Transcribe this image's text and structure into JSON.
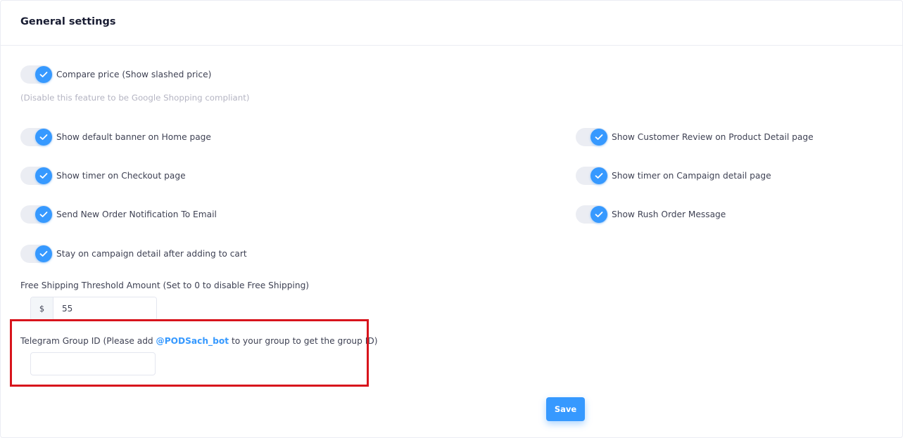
{
  "card": {
    "title": "General settings"
  },
  "toggles": {
    "compare_price": {
      "label": "Compare price (Show slashed price)",
      "checked": true
    },
    "compare_price_hint": "(Disable this feature to be Google Shopping compliant)",
    "default_banner": {
      "label": "Show default banner on Home page",
      "checked": true
    },
    "customer_review": {
      "label": "Show Customer Review on Product Detail page",
      "checked": true
    },
    "timer_checkout": {
      "label": "Show timer on Checkout page",
      "checked": true
    },
    "timer_campaign": {
      "label": "Show timer on Campaign detail page",
      "checked": true
    },
    "order_notification": {
      "label": "Send New Order Notification To Email",
      "checked": true
    },
    "rush_order": {
      "label": "Show Rush Order Message",
      "checked": true
    },
    "stay_on_campaign": {
      "label": "Stay on campaign detail after adding to cart",
      "checked": true
    }
  },
  "free_shipping": {
    "label": "Free Shipping Threshold Amount (Set to 0 to disable Free Shipping)",
    "prefix": "$",
    "value": "55"
  },
  "telegram": {
    "label_before": "Telegram Group ID (Please add ",
    "bot_link": "@PODSach_bot",
    "label_after": " to your group to get the group ID)",
    "value": "",
    "placeholder": ""
  },
  "actions": {
    "save_label": "Save"
  },
  "colors": {
    "accent": "#3699ff",
    "highlight": "#d8141c",
    "toggle_track": "#ebedf3"
  }
}
